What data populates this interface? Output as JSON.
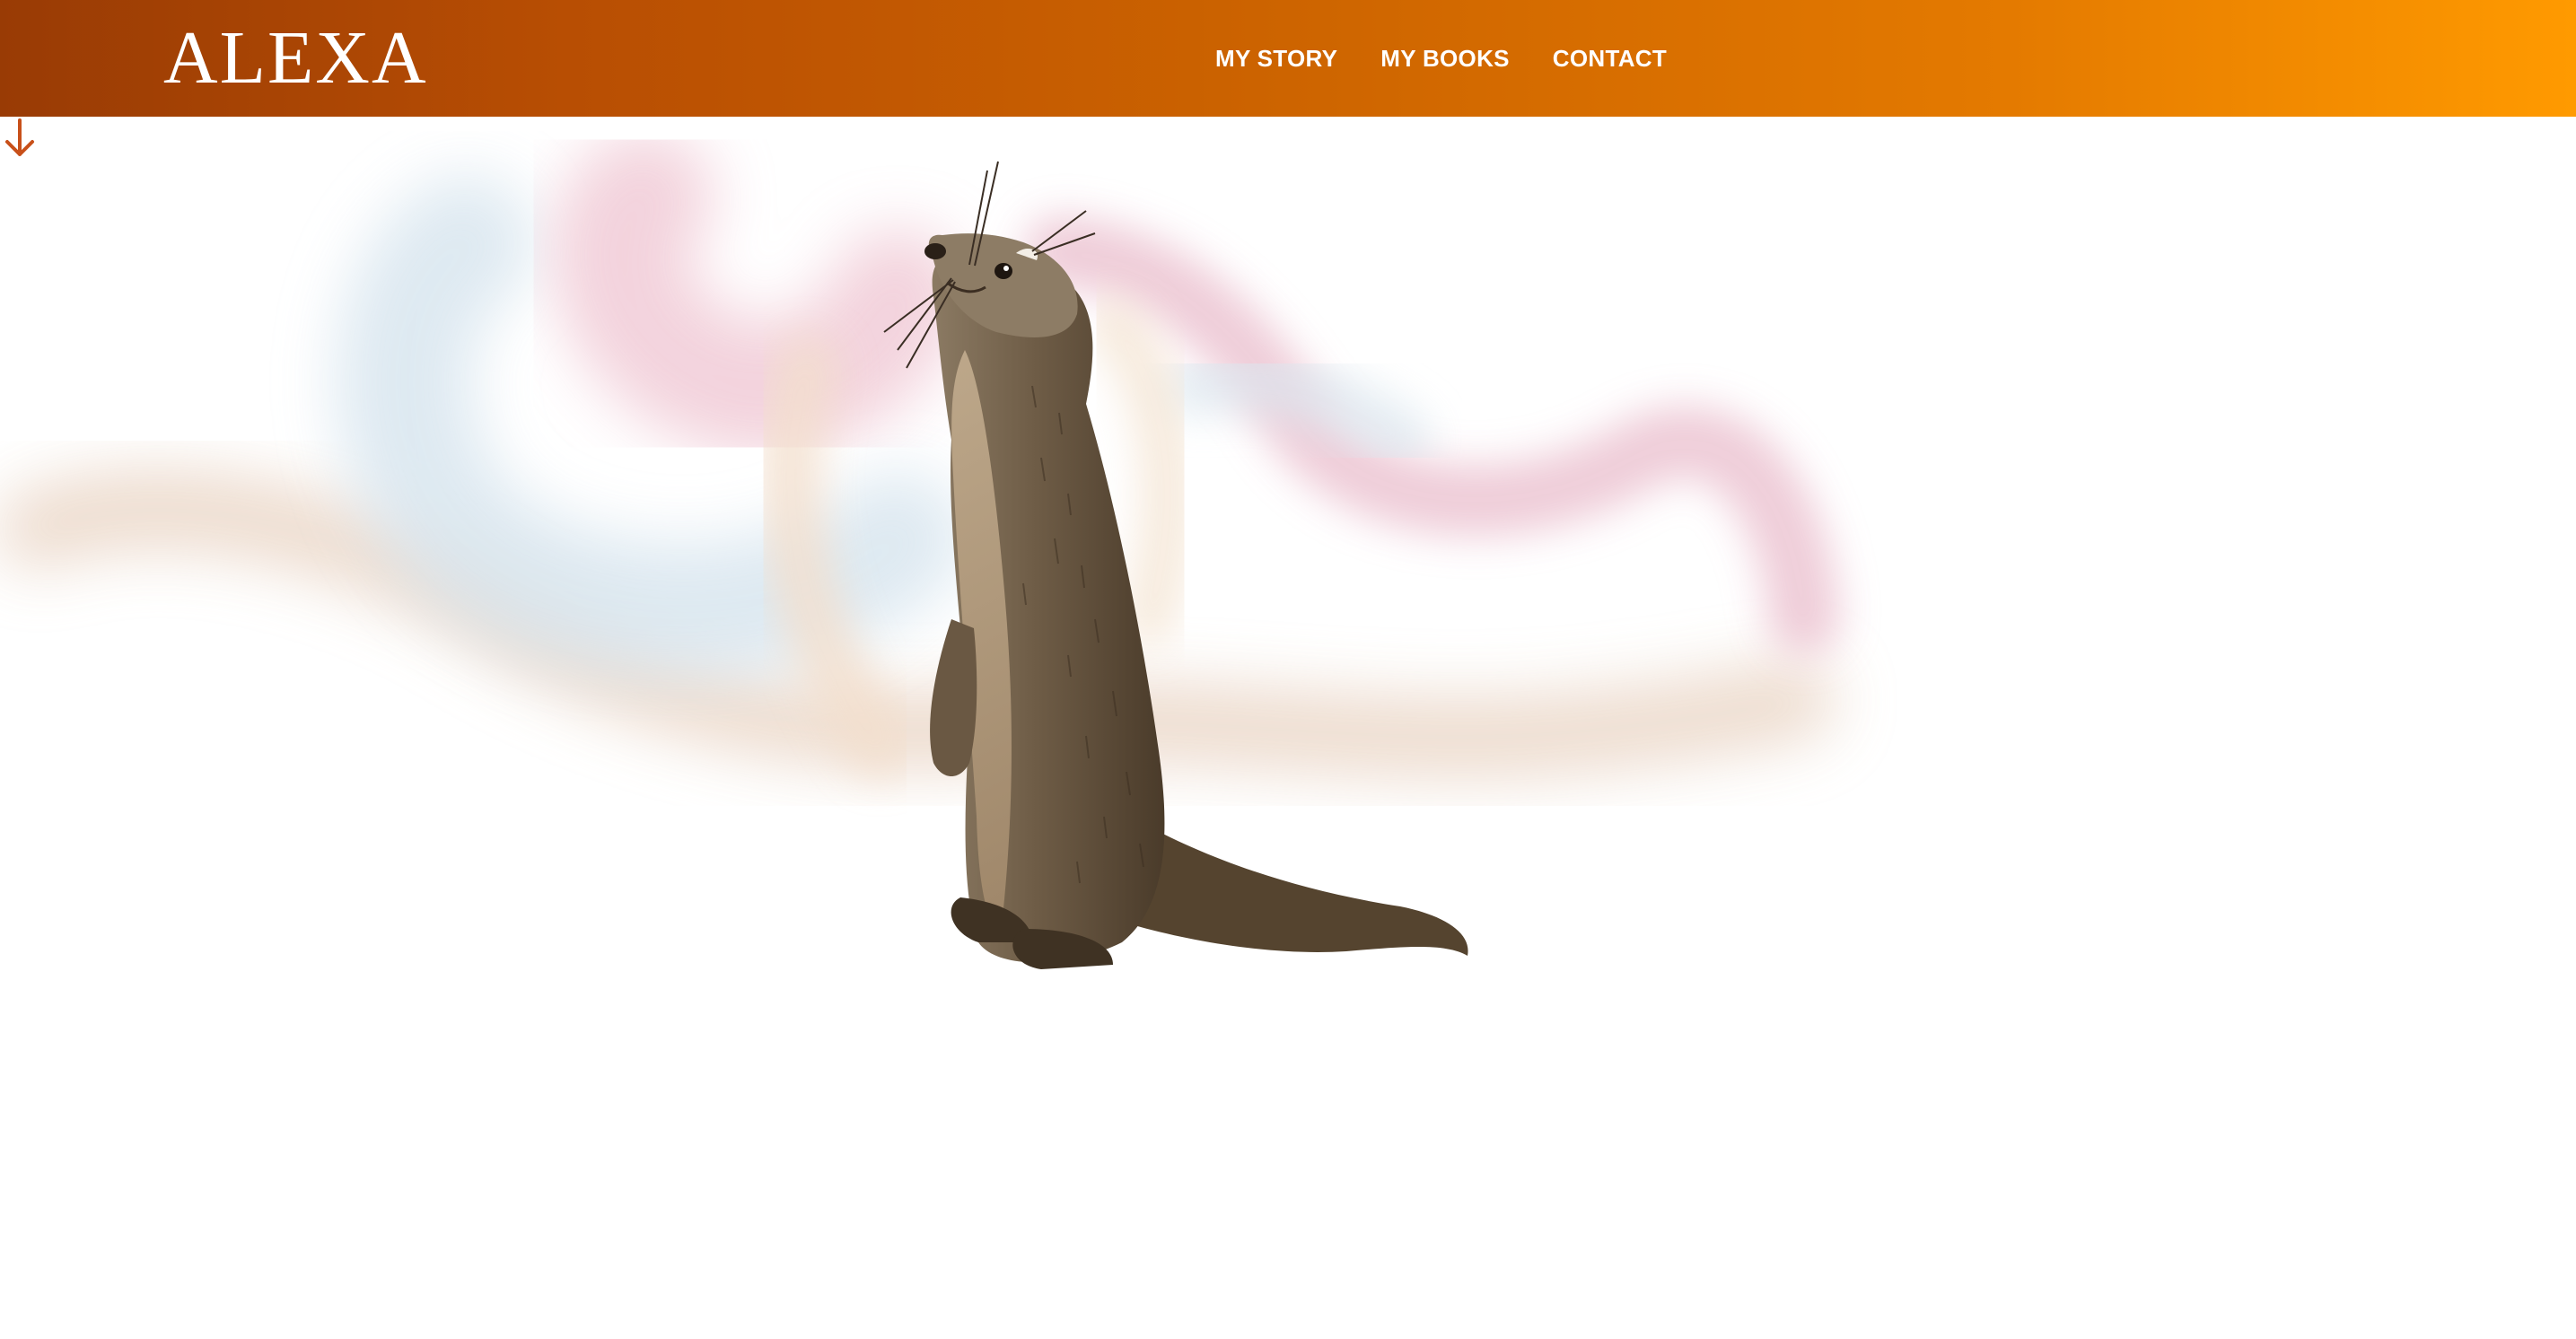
{
  "header": {
    "logo": "ALEXA",
    "nav": [
      {
        "label": "MY STORY"
      },
      {
        "label": "MY BOOKS"
      },
      {
        "label": "CONTACT"
      }
    ]
  },
  "colors": {
    "header_gradient_start": "#993b05",
    "header_gradient_end": "#ff9a00",
    "accent": "#c8501a",
    "background": "#ffffff"
  },
  "hero": {
    "illustration": "otter-watercolor",
    "scroll_icon": "arrow-down-icon"
  }
}
